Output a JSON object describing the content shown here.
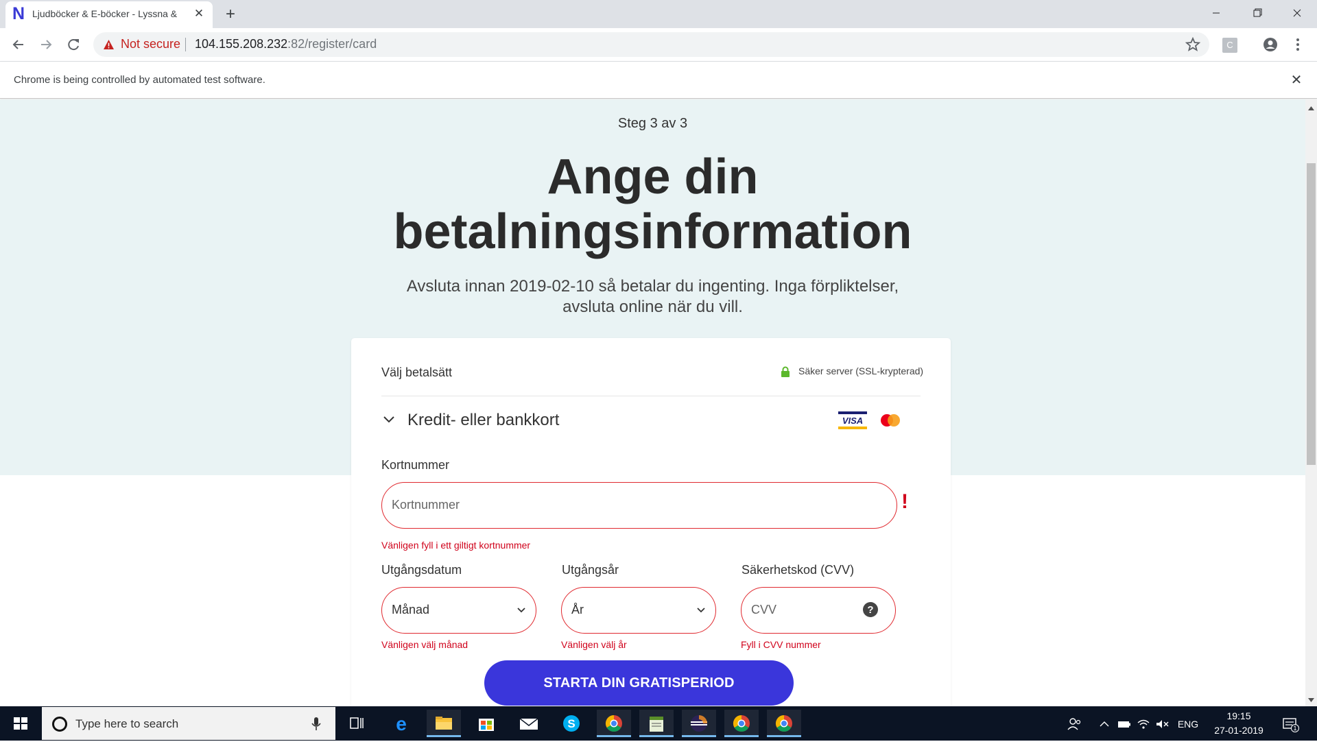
{
  "browser": {
    "tab_title": "Ljudböcker & E-böcker - Lyssna &",
    "tab_favicon": "N",
    "new_tab_label": "+",
    "security_label": "Not secure",
    "url_host": "104.155.208.232",
    "url_rest": ":82/register/card",
    "extension_label": "C",
    "infobar_text": "Chrome is being controlled by automated test software.",
    "infobar_close": "✕"
  },
  "page": {
    "step": "Steg 3 av 3",
    "heading_line1": "Ange din",
    "heading_line2": "betalningsinformation",
    "subtext": "Avsluta innan 2019-02-10 så betalar du ingenting. Inga förpliktelser, avsluta online när du vill.",
    "hero_bg_color": "#e9f3f4",
    "card": {
      "choose_label": "Välj betalsätt",
      "secure_label": "Säker server (SSL-krypterad)",
      "method_label": "Kredit- eller bankkort",
      "card_logos": [
        "VISA",
        "MasterCard"
      ],
      "card_number": {
        "label": "Kortnummer",
        "placeholder": "Kortnummer",
        "error_mark": "!",
        "error": "Vänligen fyll i ett giltigt kortnummer"
      },
      "expiry_month": {
        "label": "Utgångsdatum",
        "value": "Månad",
        "error": "Vänligen välj månad"
      },
      "expiry_year": {
        "label": "Utgångsår",
        "value": "År",
        "error": "Vänligen välj år"
      },
      "cvv": {
        "label": "Säkerhetskod (CVV)",
        "placeholder": "CVV",
        "help_icon": "?",
        "error": "Fyll i CVV nummer"
      },
      "cta_label": "STARTA DIN GRATISPERIOD",
      "cta_color": "#3a36db",
      "error_color": "#d0021b",
      "lock_color": "#5cb82c"
    }
  },
  "taskbar": {
    "search_placeholder": "Type here to search",
    "apps": [
      "task-view-icon",
      "edge-icon",
      "file-explorer-icon",
      "store-icon",
      "mail-icon",
      "skype-icon",
      "chrome-icon",
      "notepad-icon",
      "eclipse-icon",
      "chrome-icon",
      "chrome-icon"
    ],
    "language": "ENG",
    "time": "19:15",
    "date": "27-01-2019",
    "notification_count": "1"
  }
}
